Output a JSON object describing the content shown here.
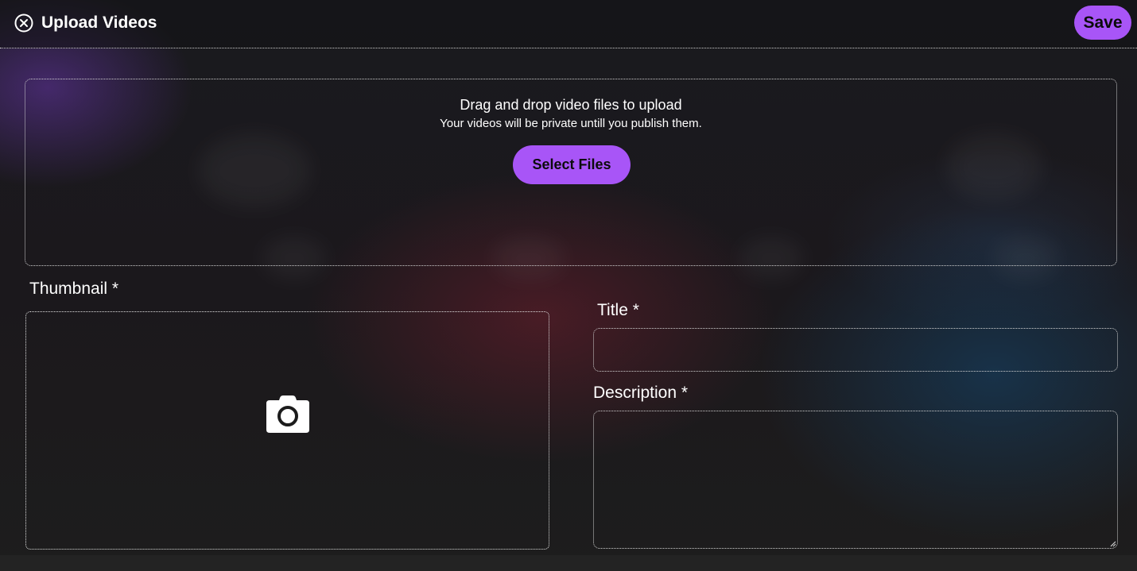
{
  "header": {
    "title": "Upload Videos",
    "close_icon": "close-circle-icon",
    "save_label": "Save"
  },
  "dropzone": {
    "title": "Drag and drop video files to upload",
    "subtitle": "Your videos will be private untill you publish them.",
    "button_label": "Select Files"
  },
  "thumbnail": {
    "label": "Thumbnail *",
    "icon": "camera-icon"
  },
  "fields": {
    "title_label": "Title *",
    "title_value": "",
    "description_label": "Description *",
    "description_value": ""
  },
  "colors": {
    "accent": "#a855f7",
    "button_text": "#0b0b0b",
    "text": "#ffffff",
    "border": "#d0d0d0"
  }
}
